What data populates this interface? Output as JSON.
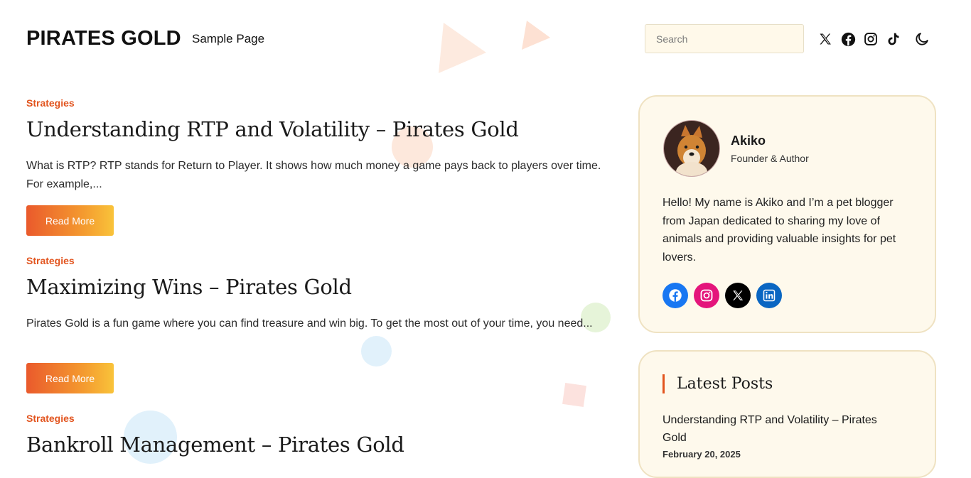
{
  "header": {
    "site_title": "PIRATES GOLD",
    "nav": [
      {
        "label": "Sample Page"
      }
    ],
    "search": {
      "placeholder": "Search",
      "value": ""
    },
    "icons": [
      "x-icon",
      "facebook-icon",
      "instagram-icon",
      "tiktok-icon",
      "dark-mode-icon"
    ]
  },
  "posts": [
    {
      "category": "Strategies",
      "title": "Understanding RTP and Volatility – Pirates Gold",
      "excerpt": "What is RTP? RTP stands for Return to Player. It shows how much money a game pays back to players over time. For example,...",
      "button": "Read More"
    },
    {
      "category": "Strategies",
      "title": "Maximizing Wins – Pirates Gold",
      "excerpt": "Pirates Gold is a fun game where you can find treasure and win big. To get the most out of your time, you need...",
      "button": "Read More"
    },
    {
      "category": "Strategies",
      "title": "Bankroll Management – Pirates Gold",
      "excerpt": "",
      "button": ""
    }
  ],
  "author": {
    "name": "Akiko",
    "role": "Founder & Author",
    "bio": "Hello! My name is Akiko and I’m a pet blogger from Japan dedicated to sharing my love of animals and providing valuable insights for pet lovers.",
    "social": [
      "facebook-icon",
      "instagram-icon",
      "x-icon",
      "linkedin-icon"
    ]
  },
  "latest_posts": {
    "heading": "Latest Posts",
    "items": [
      {
        "title": "Understanding RTP and Volatility – Pirates Gold",
        "date": "February 20, 2025"
      }
    ]
  },
  "colors": {
    "accent": "#e2541e",
    "button_gradient_start": "#ea5a2c",
    "button_gradient_end": "#f9c33a",
    "card_bg": "#fef9ec",
    "card_border": "#efe2c2",
    "facebook": "#1877f2",
    "instagram": "#e4157b",
    "linkedin": "#0a66c2"
  }
}
